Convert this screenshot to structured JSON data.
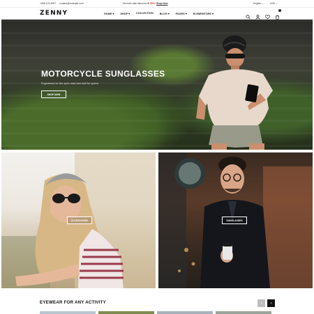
{
  "topbar": {
    "phone": "+855-123-4567",
    "email": "contact@example.com",
    "promo_prefix": "Summer sale discount off ",
    "promo_discount": "50%!",
    "promo_link": "Shop Now",
    "language": "English",
    "currency": "USD"
  },
  "header": {
    "logo": "ZENNY",
    "nav": [
      "HOME",
      "SHOP",
      "COLLECTION",
      "BLOG",
      "PAGES",
      "ELEMENTORS"
    ],
    "cart_count": "0"
  },
  "hero": {
    "title": "MOTORCYCLE SUNGLASSES",
    "subtitle": "Engineered for the open road and built for speed",
    "button": "SHOP NOW",
    "slides": 3,
    "active_slide": 1
  },
  "promos": [
    {
      "button": "ACCESSORIES"
    },
    {
      "button": "SUNGLASSES"
    }
  ],
  "section": {
    "title": "EYEWEAR FOR ANY ACTIVITY",
    "prev": "‹",
    "next": "›"
  },
  "colors": {
    "accent": "#e0302e",
    "dark": "#111111"
  }
}
